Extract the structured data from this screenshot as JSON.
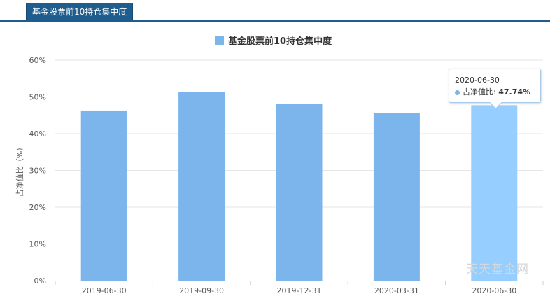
{
  "tab": {
    "label": "基金股票前10持仓集中度"
  },
  "watermark": "天天基金网",
  "colors": {
    "bar": "#7cb5ec",
    "bar_hover": "#95ceff",
    "tab": "#1f5d8e"
  },
  "tooltip": {
    "date": "2020-06-30",
    "series": "占净值比",
    "value": "47.74%"
  },
  "chart_data": {
    "type": "bar",
    "legend": "基金股票前10持仓集中度",
    "legend_position": "top",
    "ylabel": "占净值比（%）",
    "categories": [
      "2019-06-30",
      "2019-09-30",
      "2019-12-31",
      "2020-03-31",
      "2020-06-30"
    ],
    "series": [
      {
        "name": "基金股票前10持仓集中度",
        "values": [
          46.3,
          51.4,
          48.1,
          45.7,
          47.74
        ]
      }
    ],
    "ylim": [
      0,
      60
    ],
    "yticks": [
      "0%",
      "10%",
      "20%",
      "30%",
      "40%",
      "50%",
      "60%"
    ],
    "grid": true,
    "highlight_index": 4
  }
}
